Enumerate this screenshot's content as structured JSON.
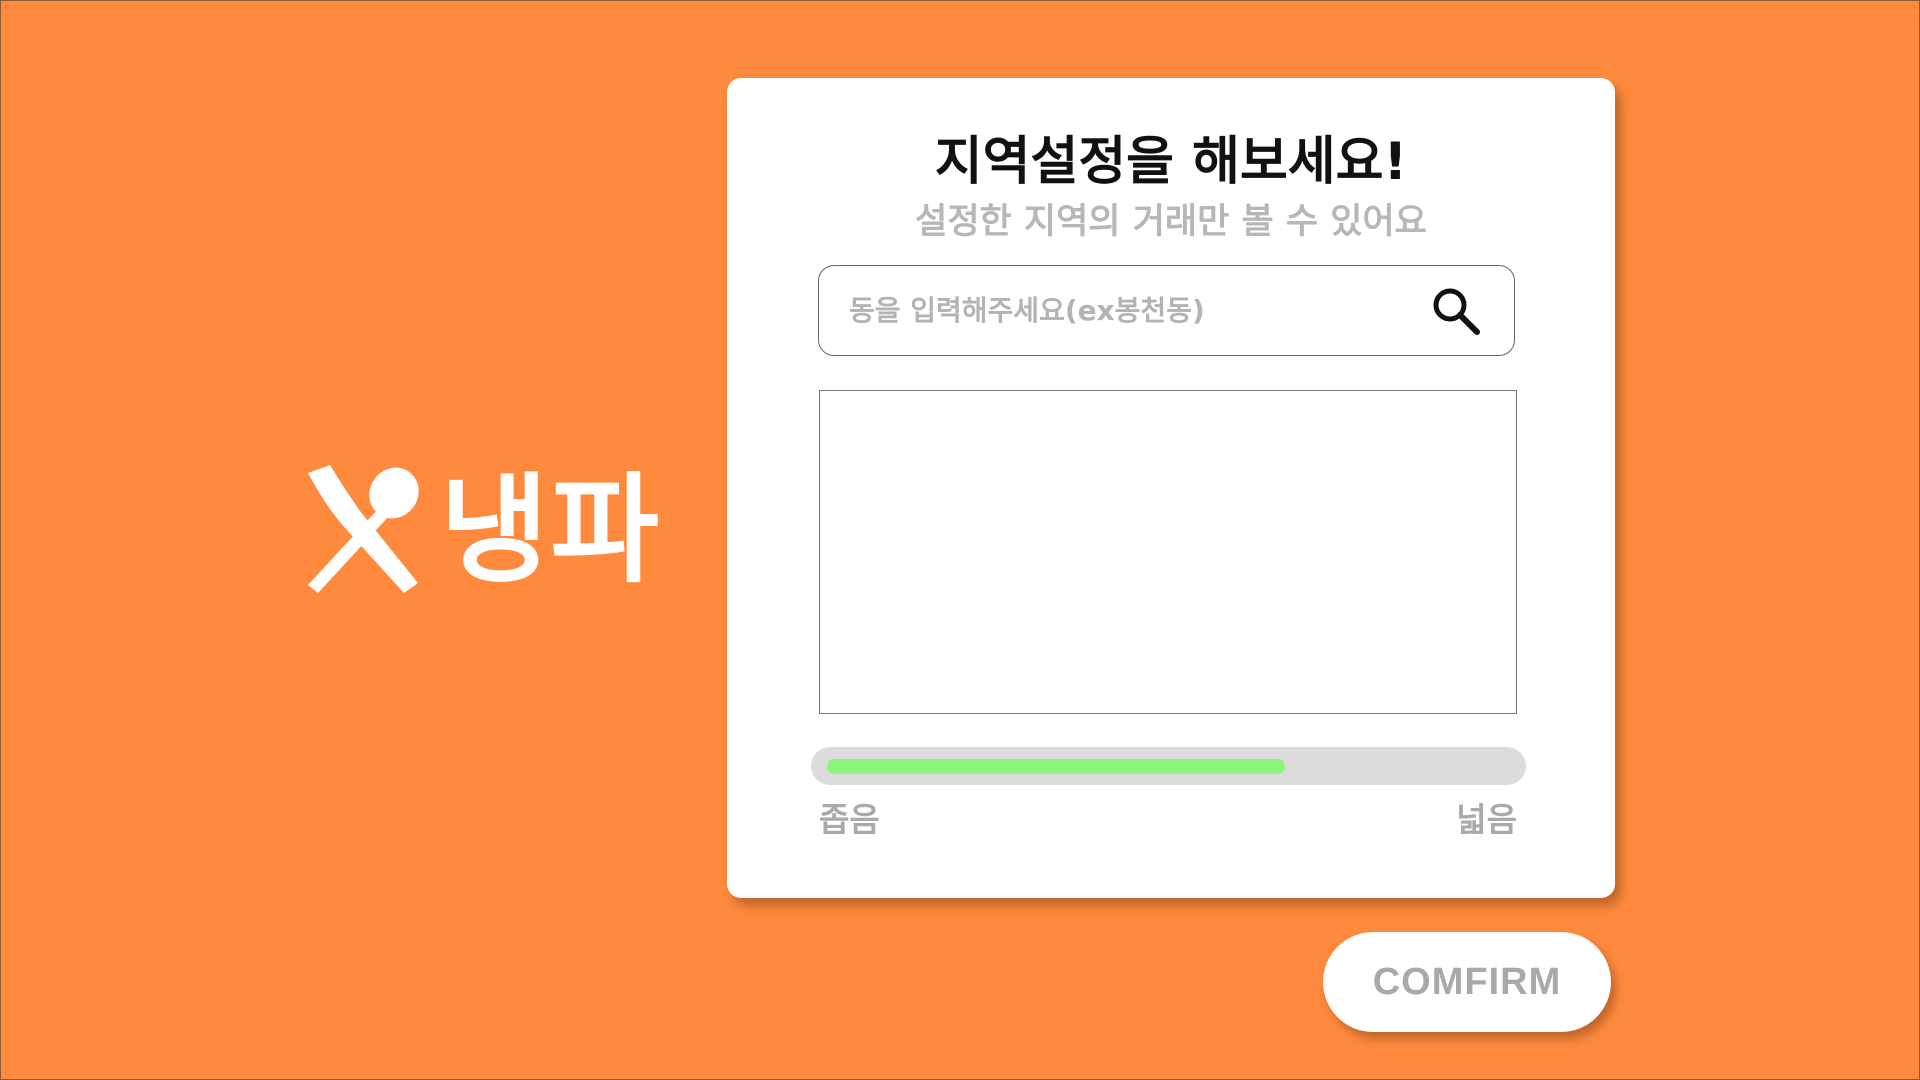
{
  "brand": {
    "name": "냉파",
    "icon": "fork-spoon-icon"
  },
  "card": {
    "title": "지역설정을 해보세요!",
    "subtitle": "설정한 지역의 거래만 볼 수 있어요",
    "search": {
      "placeholder": "동을 입력해주세요(ex봉천동)",
      "value": "",
      "icon": "search-icon"
    },
    "results": [],
    "range": {
      "value_fraction": 0.67,
      "min_label": "좁음",
      "max_label": "넓음",
      "fill_color": "#8EF57B"
    }
  },
  "confirm_label": "COMFIRM",
  "colors": {
    "background": "#FF8A3D",
    "card": "#FFFFFF"
  }
}
